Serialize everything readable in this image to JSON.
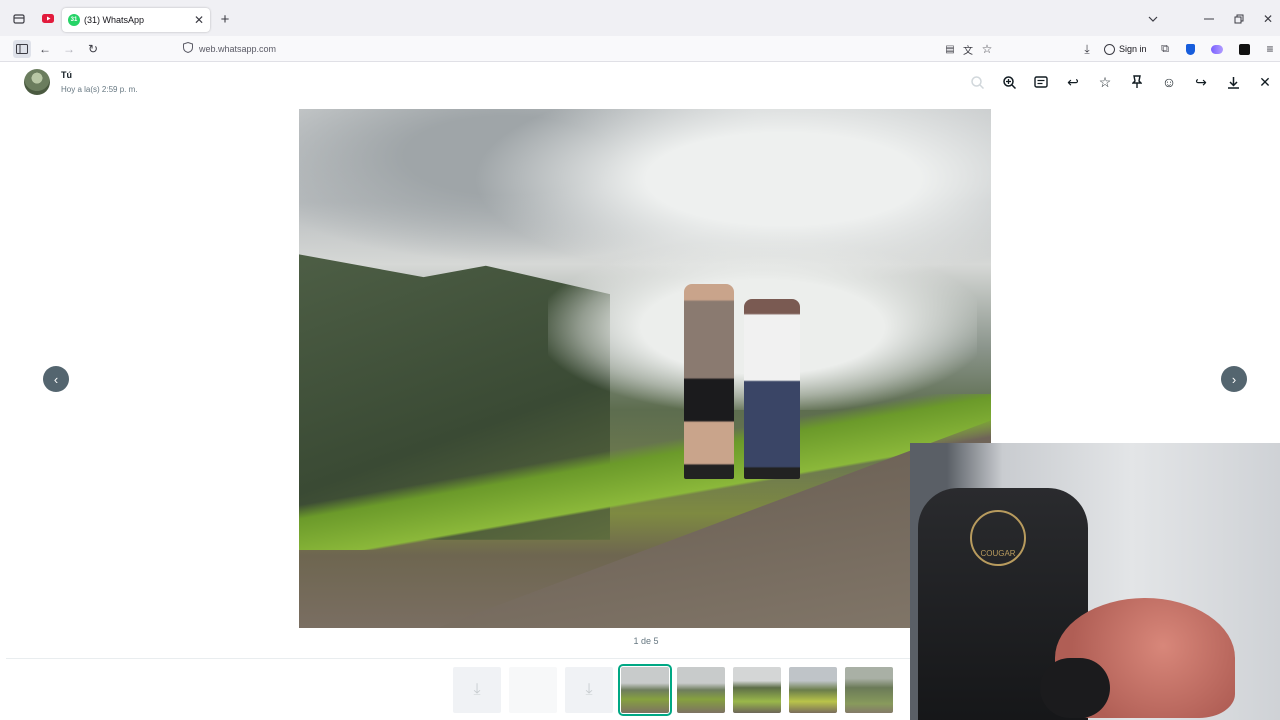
{
  "browser": {
    "tab_title": "(31) WhatsApp",
    "tab_badge": "31",
    "url": "web.whatsapp.com",
    "sign_in": "Sign in",
    "icons": [
      "tab-list-icon",
      "youtube-icon",
      "close-icon",
      "new-tab-icon",
      "chevron-down-icon",
      "minimize-icon",
      "restore-icon",
      "window-close-icon",
      "sidebar-icon",
      "back-icon",
      "forward-icon",
      "reload-icon",
      "shield-icon",
      "reader-view-icon",
      "translate-icon",
      "bookmark-star-icon",
      "downloads-icon",
      "account-icon",
      "extensions-icon",
      "bitwarden-icon",
      "extension-icon",
      "notion-icon",
      "menu-icon"
    ]
  },
  "viewer": {
    "sender_name": "Tú",
    "sender_time": "Hoy a la(s) 2:59 p. m.",
    "counter": "1 de 5",
    "actions": [
      "zoom-out-icon",
      "zoom-in-icon",
      "caption-icon",
      "reply-icon",
      "star-icon",
      "pin-icon",
      "react-emoji-icon",
      "forward-icon",
      "download-icon",
      "close-icon"
    ],
    "prev_arrow": "‹",
    "next_arrow": "›"
  },
  "webcam": {
    "chair_brand": "COUGAR"
  }
}
